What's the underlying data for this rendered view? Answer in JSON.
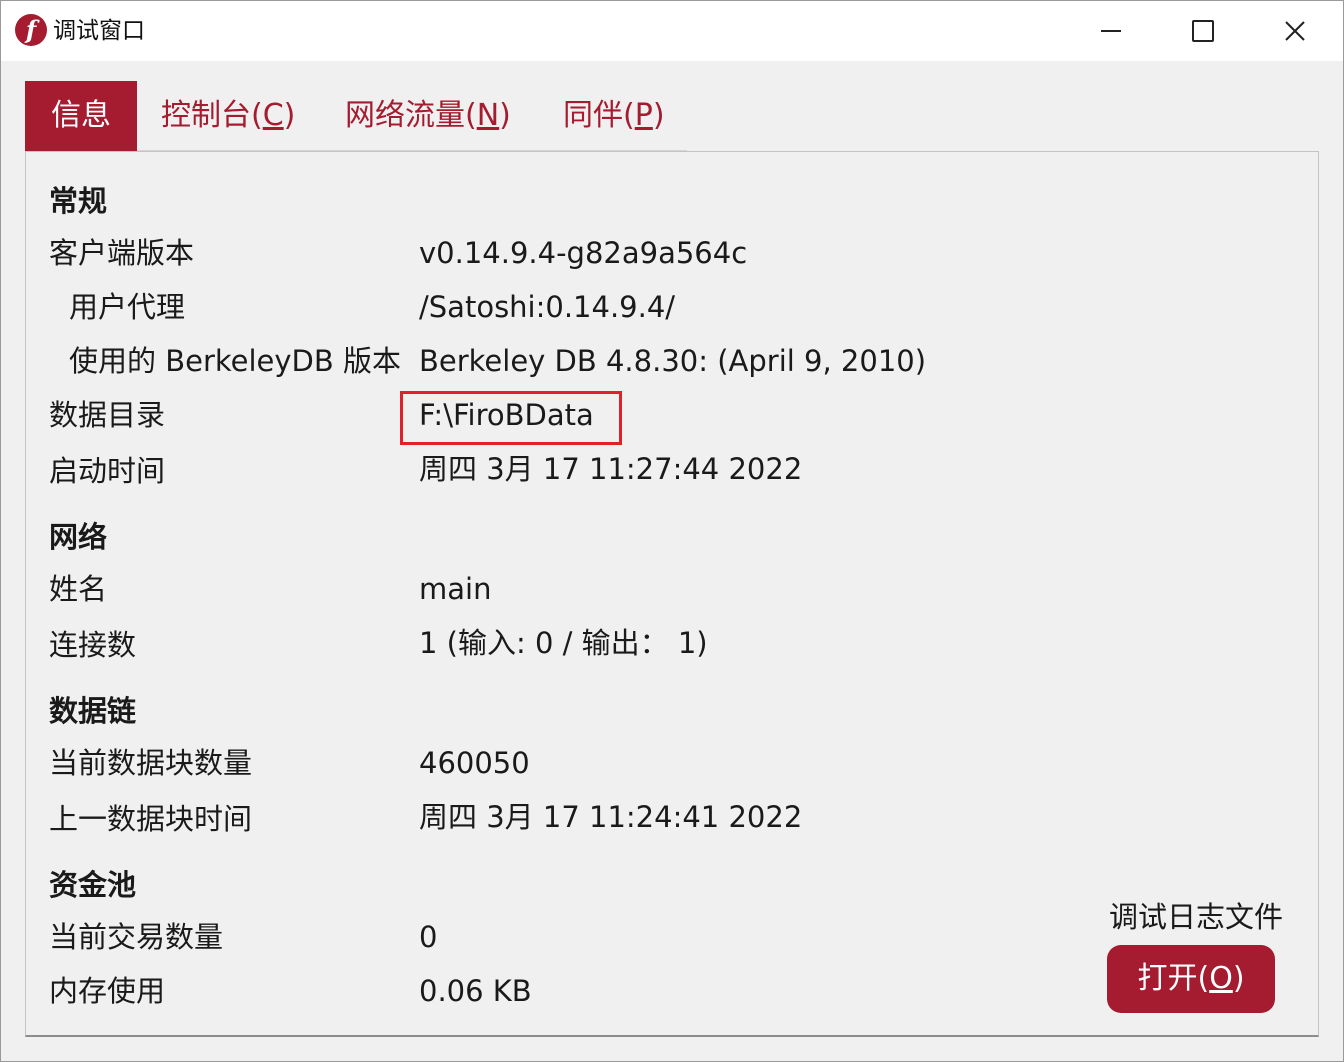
{
  "window": {
    "title": "调试窗口",
    "accent_color": "#a51c30",
    "icon": "firo-logo-icon",
    "controls": [
      "minimize-icon",
      "maximize-icon",
      "close-icon"
    ]
  },
  "tabs": [
    {
      "label": "信息",
      "active": true
    },
    {
      "label": "控制台(C)",
      "active": false
    },
    {
      "label": "网络流量(N)",
      "active": false
    },
    {
      "label": "同伴(P)",
      "active": false
    }
  ],
  "general": {
    "heading": "常规",
    "client_version_label": "客户端版本",
    "client_version_value": "v0.14.9.4-g82a9a564c",
    "user_agent_label": "用户代理",
    "user_agent_value": "/Satoshi:0.14.9.4/",
    "berkeley_label": "使用的 BerkeleyDB 版本",
    "berkeley_value": "Berkeley DB 4.8.30: (April  9, 2010)",
    "datadir_label": "数据目录",
    "datadir_value": "F:\\FiroBData",
    "startup_label": "启动时间",
    "startup_value": "周四 3月 17 11:27:44 2022"
  },
  "network": {
    "heading": "网络",
    "name_label": "姓名",
    "name_value": "main",
    "connections_label": "连接数",
    "connections_value": "1 (输入: 0 / 输出：  1)"
  },
  "blockchain": {
    "heading": "数据链",
    "blocks_label": "当前数据块数量",
    "blocks_value": "460050",
    "lastblock_label": "上一数据块时间",
    "lastblock_value": "周四 3月 17 11:24:41 2022"
  },
  "mempool": {
    "heading": "资金池",
    "tx_label": "当前交易数量",
    "tx_value": "0",
    "mem_label": "内存使用",
    "mem_value": "0.06 KB"
  },
  "debug_log": {
    "label": "调试日志文件",
    "button_label": "打开(O)"
  }
}
